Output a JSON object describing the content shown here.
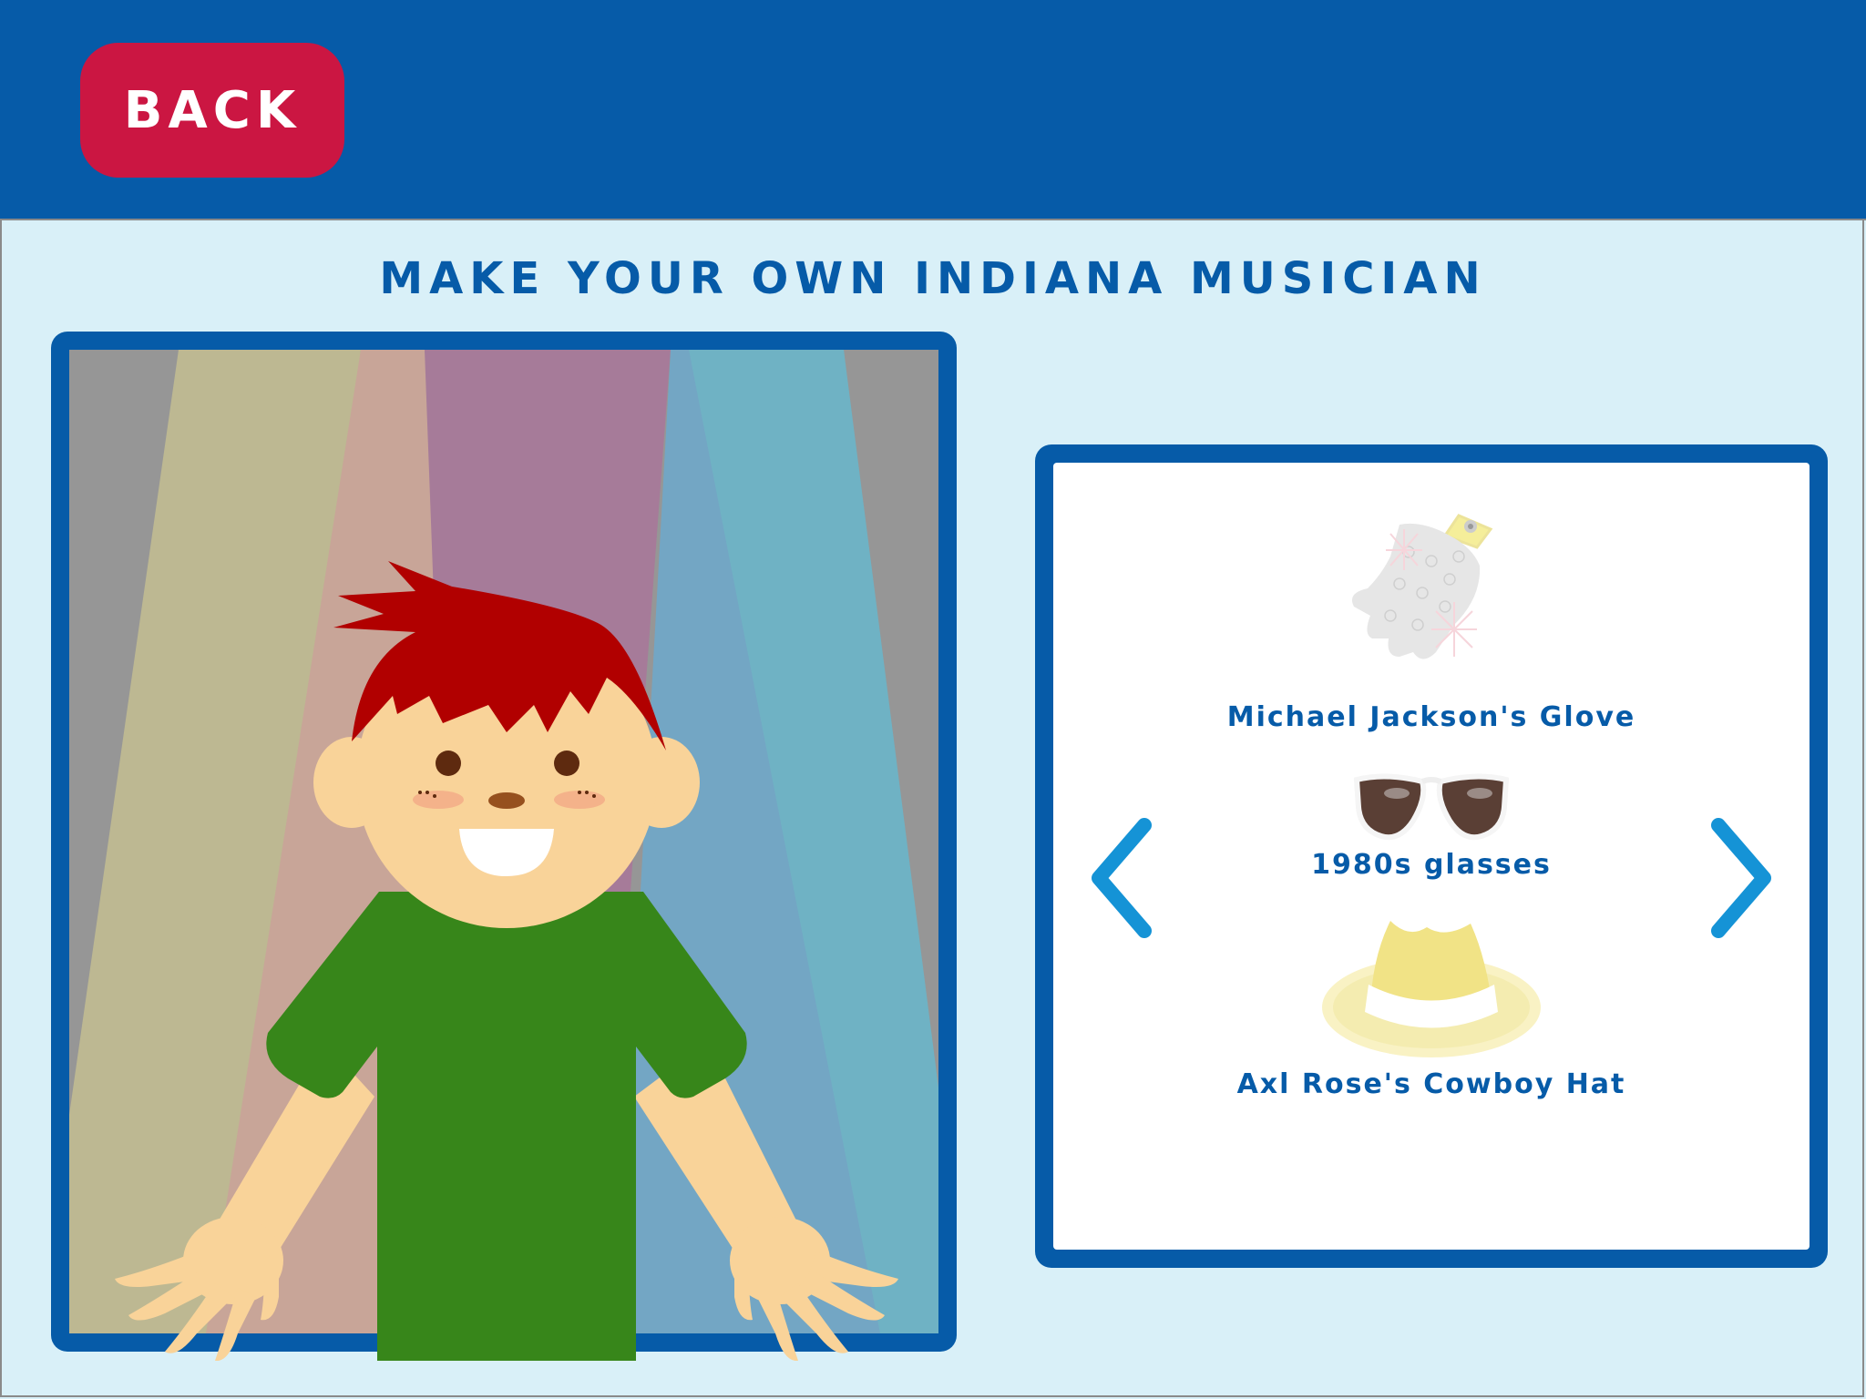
{
  "header": {
    "back_label": "BACK"
  },
  "page": {
    "title": "MAKE YOUR OWN INDIANA MUSICIAN"
  },
  "accessories": {
    "items": [
      {
        "label": "Michael Jackson's Glove",
        "icon": "glove-icon"
      },
      {
        "label": "1980s glasses",
        "icon": "sunglasses-icon"
      },
      {
        "label": "Axl Rose's Cowboy Hat",
        "icon": "cowboy-hat-icon"
      }
    ],
    "prev_icon": "chevron-left-icon",
    "next_icon": "chevron-right-icon"
  },
  "colors": {
    "header_bg": "#065ba8",
    "back_button": "#cb1642",
    "page_bg": "#d9f0f8",
    "arrow": "#1593d6",
    "hair": "#b10000",
    "shirt": "#37861a",
    "skin": "#f9d399"
  }
}
